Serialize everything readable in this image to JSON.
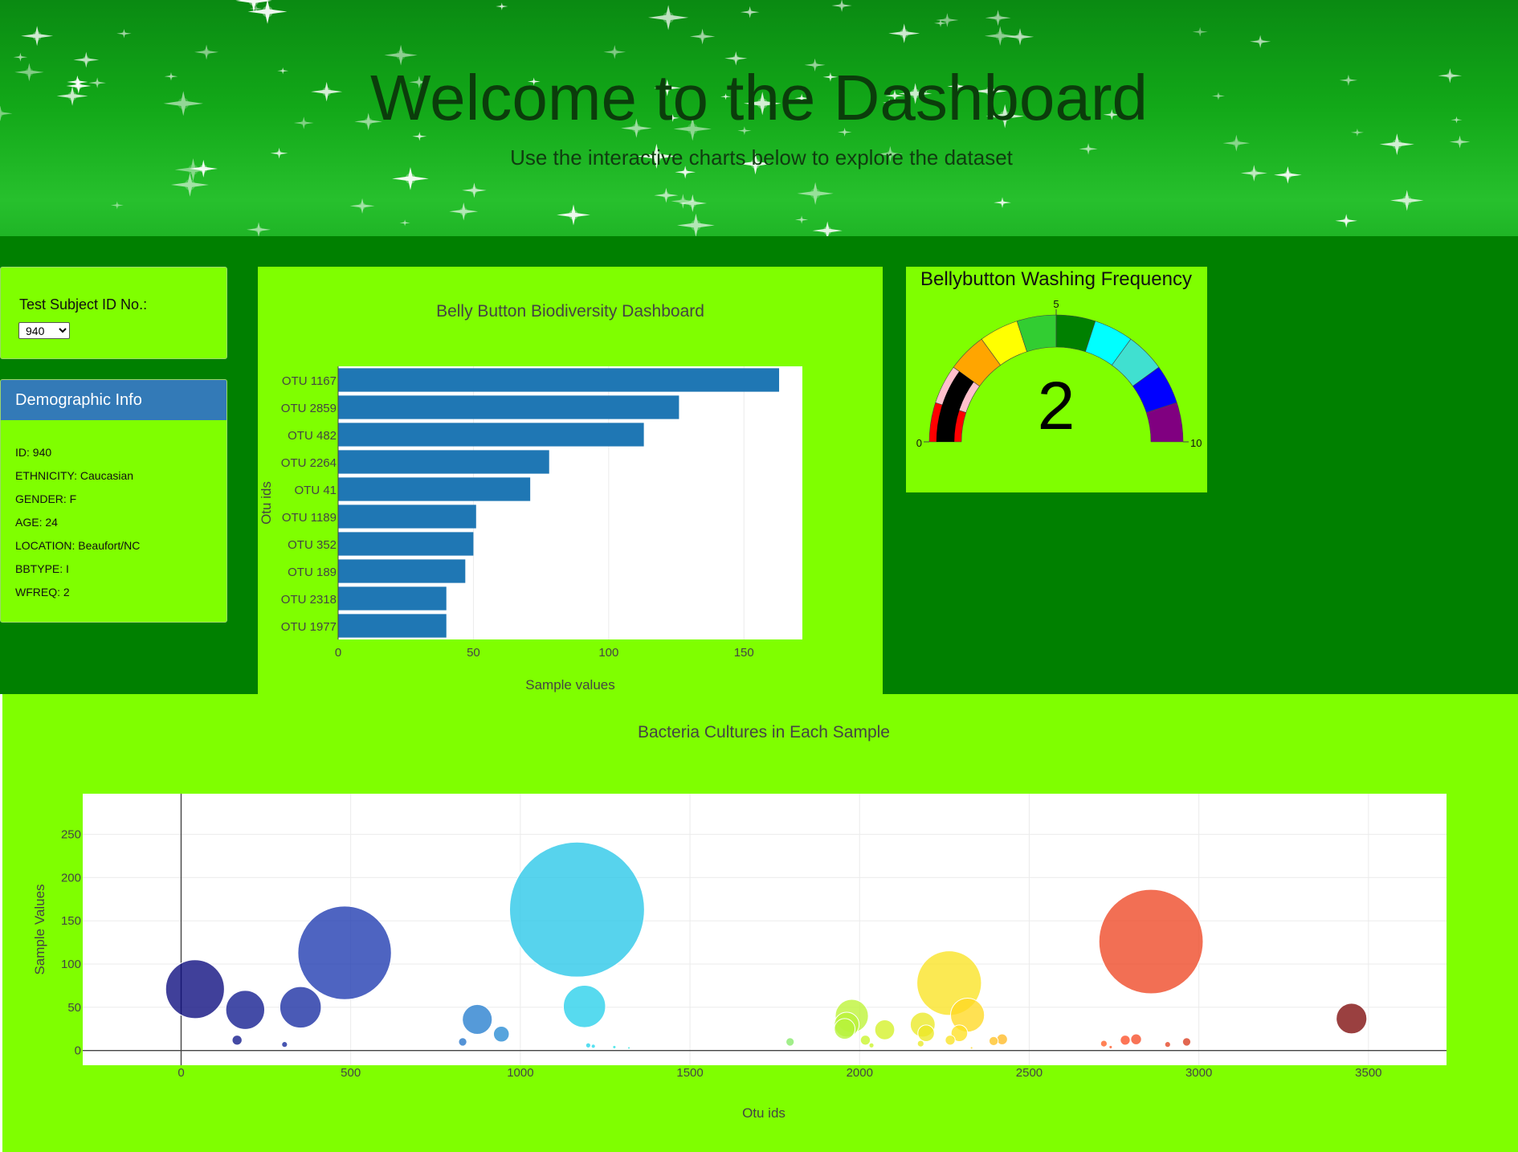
{
  "header": {
    "title": "Welcome to the Dashboard",
    "subtitle": "Use the interactive charts below to explore the dataset"
  },
  "selector": {
    "label": "Test Subject ID No.:",
    "selected": "940"
  },
  "demographics": {
    "heading": "Demographic Info",
    "items": [
      "ID: 940",
      "ETHNICITY: Caucasian",
      "GENDER: F",
      "AGE: 24",
      "LOCATION: Beaufort/NC",
      "BBTYPE: I",
      "WFREQ: 2"
    ]
  },
  "colors": {
    "page_band": "#008000",
    "panel": "#7fff00",
    "demo_heading": "#337ab7",
    "bar": "#1f77b4"
  },
  "chart_data": [
    {
      "type": "bar",
      "orientation": "horizontal",
      "title": "Belly Button Biodiversity Dashboard",
      "xlabel": "Sample values",
      "ylabel": "Otu ids",
      "categories": [
        "OTU 1167",
        "OTU 2859",
        "OTU 482",
        "OTU 2264",
        "OTU 41",
        "OTU 1189",
        "OTU 352",
        "OTU 189",
        "OTU 2318",
        "OTU 1977"
      ],
      "values": [
        163,
        126,
        113,
        78,
        71,
        51,
        50,
        47,
        40,
        40
      ],
      "xlim": [
        0,
        171.6
      ],
      "xticks": [
        0,
        50,
        100,
        150
      ]
    },
    {
      "type": "gauge",
      "title": "Bellybutton Washing Frequency",
      "value": 2,
      "range": [
        0,
        10
      ],
      "tick_labels": [
        "0",
        "5",
        "10"
      ],
      "band_colors": [
        "red",
        "pink",
        "orange",
        "yellow",
        "limegreen",
        "green",
        "cyan",
        "turquoise",
        "blue",
        "purple"
      ],
      "bar_color": "black"
    },
    {
      "type": "scatter",
      "mode": "bubble",
      "title": "Bacteria Cultures in Each Sample",
      "xlabel": "Otu ids",
      "ylabel": "Sample Values",
      "xlim": [
        -290,
        3730
      ],
      "ylim": [
        -17,
        297
      ],
      "xticks": [
        0,
        500,
        1000,
        1500,
        2000,
        2500,
        3000,
        3500
      ],
      "yticks": [
        0,
        50,
        100,
        150,
        200,
        250
      ],
      "colorscale_range": [
        41,
        3450
      ],
      "points": [
        {
          "x": 41,
          "y": 71
        },
        {
          "x": 189,
          "y": 47
        },
        {
          "x": 352,
          "y": 50
        },
        {
          "x": 482,
          "y": 113
        },
        {
          "x": 165,
          "y": 12
        },
        {
          "x": 305,
          "y": 7
        },
        {
          "x": 873,
          "y": 36
        },
        {
          "x": 944,
          "y": 19
        },
        {
          "x": 830,
          "y": 10
        },
        {
          "x": 1167,
          "y": 163
        },
        {
          "x": 1189,
          "y": 51
        },
        {
          "x": 1200,
          "y": 6
        },
        {
          "x": 1215,
          "y": 5
        },
        {
          "x": 1277,
          "y": 4
        },
        {
          "x": 1320,
          "y": 3
        },
        {
          "x": 1795,
          "y": 10
        },
        {
          "x": 1977,
          "y": 40
        },
        {
          "x": 1962,
          "y": 30
        },
        {
          "x": 1956,
          "y": 25
        },
        {
          "x": 2017,
          "y": 12
        },
        {
          "x": 2035,
          "y": 6
        },
        {
          "x": 2074,
          "y": 24
        },
        {
          "x": 2186,
          "y": 30
        },
        {
          "x": 2196,
          "y": 20
        },
        {
          "x": 2180,
          "y": 8
        },
        {
          "x": 2264,
          "y": 78
        },
        {
          "x": 2318,
          "y": 41
        },
        {
          "x": 2294,
          "y": 20
        },
        {
          "x": 2267,
          "y": 12
        },
        {
          "x": 2395,
          "y": 11
        },
        {
          "x": 2420,
          "y": 13
        },
        {
          "x": 2330,
          "y": 3
        },
        {
          "x": 2720,
          "y": 8
        },
        {
          "x": 2740,
          "y": 4
        },
        {
          "x": 2783,
          "y": 12
        },
        {
          "x": 2815,
          "y": 13
        },
        {
          "x": 2859,
          "y": 126
        },
        {
          "x": 2908,
          "y": 7
        },
        {
          "x": 2964,
          "y": 10
        },
        {
          "x": 3450,
          "y": 37
        }
      ]
    }
  ]
}
